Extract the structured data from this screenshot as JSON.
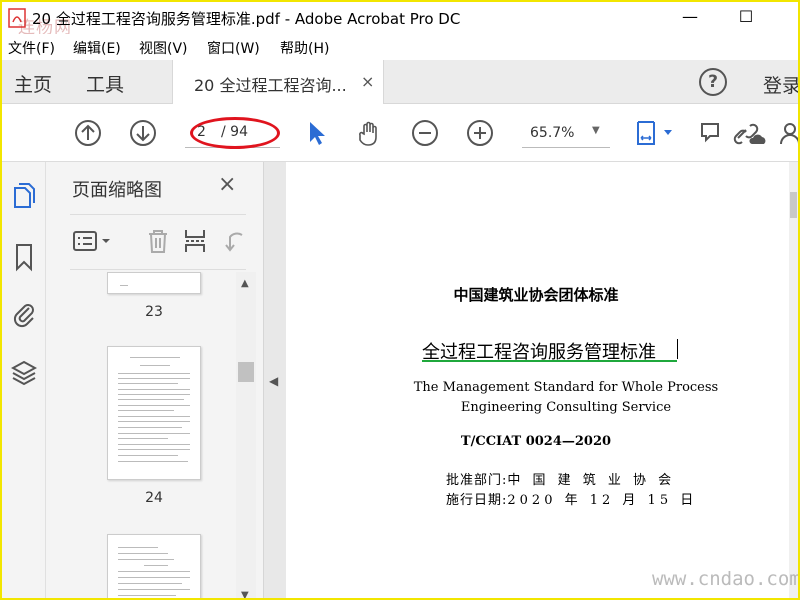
{
  "window": {
    "title": "20 全过程工程咨询服务管理标准.pdf - Adobe Acrobat Pro DC",
    "logo_text": "连杨网",
    "minimize": "—",
    "maximize": "☐"
  },
  "menu": [
    {
      "label": "文件(F)"
    },
    {
      "label": "编辑(E)"
    },
    {
      "label": "视图(V)"
    },
    {
      "label": "窗口(W)"
    },
    {
      "label": "帮助(H)"
    }
  ],
  "tabs": {
    "home": "主页",
    "tools": "工具",
    "doc": "20 全过程工程咨询...",
    "close": "×",
    "help": "?",
    "login": "登录"
  },
  "toolbar": {
    "page_current": "2",
    "page_total": "/ 94",
    "zoom": "65.7%",
    "zoom_caret": "▼"
  },
  "panel": {
    "title": "页面缩略图",
    "close": "×",
    "thumbnails": [
      {
        "page": "23"
      },
      {
        "page": "24"
      }
    ]
  },
  "scroll": {
    "up": "▲",
    "down": "▼"
  },
  "collapse_arrow": "◀",
  "document": {
    "org_title": "中国建筑业协会团体标准",
    "title_cn": "全过程工程咨询服务管理标准",
    "title_en_1": "The Management Standard for Whole Process",
    "title_en_2": "Engineering Consulting Service",
    "code": "T/CCIAT 0024—2020",
    "approval_label": "批准部门:",
    "approval_value": "中 国 建 筑 业 协 会",
    "effective_label": "施行日期:",
    "effective_value": "2020 年 12 月 15 日"
  },
  "watermark": "www.cndao.com",
  "colors": {
    "accent_blue": "#2b6cd4",
    "annotation_red": "#e0141e",
    "underline_green": "#1fa83c",
    "frame_yellow": "#f2e600"
  }
}
